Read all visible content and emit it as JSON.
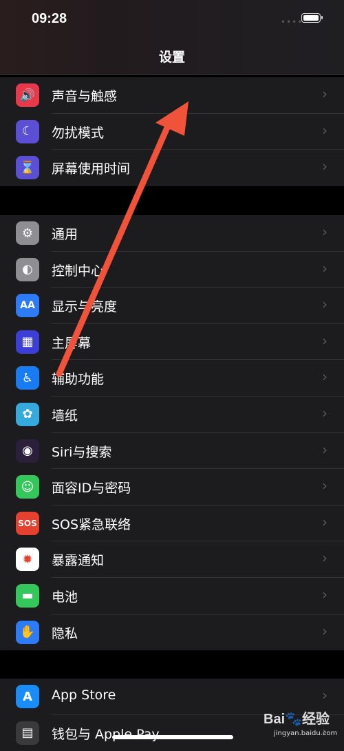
{
  "status": {
    "time": "09:28",
    "signal": "••••"
  },
  "nav": {
    "title": "设置"
  },
  "groups": [
    {
      "items": [
        {
          "label": "声音与触感",
          "icon": "speaker-icon",
          "glyph": "🔊",
          "color": "#e8394b"
        },
        {
          "label": "勿扰模式",
          "icon": "moon-icon",
          "glyph": "☾",
          "color": "#5b4fd6"
        },
        {
          "label": "屏幕使用时间",
          "icon": "hourglass-icon",
          "glyph": "⌛",
          "color": "#5b4fd6"
        }
      ]
    },
    {
      "items": [
        {
          "label": "通用",
          "icon": "gear-icon",
          "glyph": "⚙",
          "color": "#8e8e93"
        },
        {
          "label": "控制中心",
          "icon": "toggles-icon",
          "glyph": "◐",
          "color": "#8e8e93"
        },
        {
          "label": "显示与亮度",
          "icon": "text-size-icon",
          "glyph": "AA",
          "color": "#2d7cf6"
        },
        {
          "label": "主屏幕",
          "icon": "home-grid-icon",
          "glyph": "▦",
          "color": "#3b3fd8"
        },
        {
          "label": "辅助功能",
          "icon": "accessibility-icon",
          "glyph": "♿",
          "color": "#1a7cf2"
        },
        {
          "label": "墙纸",
          "icon": "flower-icon",
          "glyph": "✿",
          "color": "#36aadc"
        },
        {
          "label": "Siri与搜索",
          "icon": "siri-icon",
          "glyph": "◉",
          "color": "#2b1f3a"
        },
        {
          "label": "面容ID与密码",
          "icon": "face-id-icon",
          "glyph": "☺",
          "color": "#34c759"
        },
        {
          "label": "SOS紧急联络",
          "icon": "sos-icon",
          "glyph": "SOS",
          "color": "#e5412f"
        },
        {
          "label": "暴露通知",
          "icon": "exposure-icon",
          "glyph": "✹",
          "color": "#ffffff",
          "glyphColor": "#e5412f"
        },
        {
          "label": "电池",
          "icon": "battery-icon",
          "glyph": "▬",
          "color": "#34c759"
        },
        {
          "label": "隐私",
          "icon": "hand-icon",
          "glyph": "✋",
          "color": "#2d7cf6"
        }
      ]
    },
    {
      "items": [
        {
          "label": "App Store",
          "icon": "app-store-icon",
          "glyph": "A",
          "color": "#1a8cf8"
        },
        {
          "label": "钱包与 Apple Pay",
          "icon": "wallet-icon",
          "glyph": "▤",
          "color": "#3a3a3c"
        }
      ]
    }
  ],
  "watermark": {
    "text": "Bai🐾经验",
    "sub": "jingyan.baidu.com"
  },
  "colors": {
    "background": "#000000",
    "group": "#1c1c1e",
    "arrow": "#f0533a"
  }
}
